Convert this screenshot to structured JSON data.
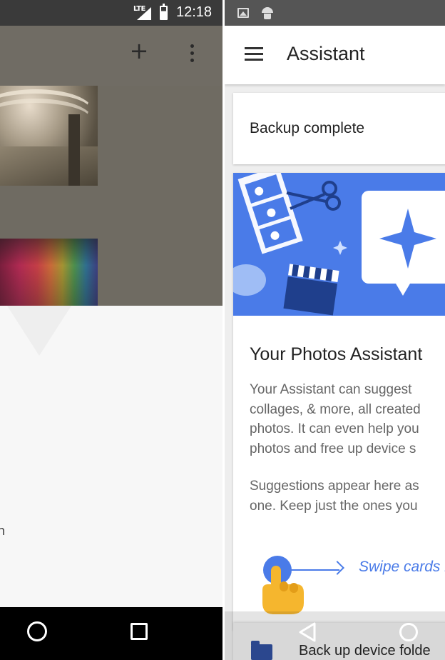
{
  "left_phone": {
    "status_bar": {
      "network": "LTE",
      "time": "12:18"
    },
    "toolbar": {
      "add_icon": "plus-icon",
      "more_icon": "more-vert-icon"
    },
    "photos": [
      "architecture-photo",
      "rainbow-wall-photo"
    ],
    "nav_bar": {
      "home_icon": "circle-home-icon",
      "recents_icon": "square-recents-icon"
    }
  },
  "right_phone": {
    "status_bar": {
      "icons": [
        "image-icon",
        "android-icon"
      ]
    },
    "toolbar": {
      "menu_icon": "hamburger-menu-icon",
      "title": "Assistant"
    },
    "backup_card": {
      "text": "Backup complete"
    },
    "assistant_card": {
      "title": "Your Photos Assistant",
      "paragraph1": [
        "Your Assistant can suggest",
        "collages, & more, all created",
        "photos. It can even help you",
        "photos and free up device s"
      ],
      "paragraph2": [
        "Suggestions appear here as",
        "one. Keep just the ones you"
      ],
      "swipe_hint": "Swipe cards r"
    },
    "folder_card": {
      "text": "Back up device folde"
    },
    "nav_bar": {
      "back_icon": "triangle-back-icon",
      "home_icon": "circle-home-icon"
    }
  },
  "colors": {
    "accent_blue": "#4a7be8",
    "hand_orange": "#f5b62e",
    "dim_overlay": "#706c64"
  }
}
